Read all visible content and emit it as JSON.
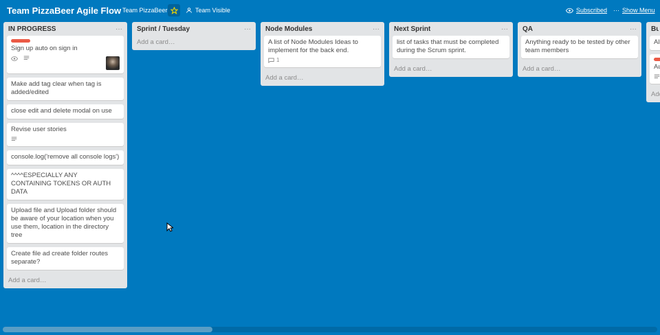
{
  "header": {
    "board_title": "Team PizzaBeer Agile Flow",
    "team": "Team PizzaBeer",
    "visibility": "Team Visible",
    "subscribed": "Subscribed",
    "show_menu": "Show Menu"
  },
  "lists": {
    "in_progress": {
      "title": "IN PROGRESS",
      "menu": "···",
      "cards": [
        "Sign up auto on sign in",
        "Make add tag clear when tag is added/edited",
        "close edit and delete modal on use",
        "Revise user stories",
        "console.log('remove all console logs')",
        "^^^^ESPECIALLY ANY CONTAINING TOKENS OR AUTH DATA",
        "Upload file and Upload folder should be aware of your location when you use them, location in the directory tree",
        "Create file ad create folder routes separate?"
      ],
      "add": "Add a card…"
    },
    "sprint": {
      "title": "Sprint / Tuesday",
      "menu": "···",
      "add": "Add a card…"
    },
    "node": {
      "title": "Node Modules",
      "menu": "···",
      "cards": [
        "A list of Node Modules Ideas to implement for the back end."
      ],
      "comment_count": "1",
      "add": "Add a card…"
    },
    "next": {
      "title": "Next Sprint",
      "menu": "···",
      "cards": [
        "list of tasks that must be completed during the Scrum sprint."
      ],
      "add": "Add a card…"
    },
    "qa": {
      "title": "QA",
      "menu": "···",
      "cards": [
        "Anything ready to be tested by other team members"
      ],
      "add": "Add a card…"
    },
    "bugs": {
      "title": "Bu",
      "cards": [
        "Al",
        "Au"
      ],
      "add": "Add"
    }
  },
  "colors": {
    "board": "#0079bf",
    "list": "#e2e4e6",
    "label_red": "#eb5a46"
  },
  "scroll": {
    "thumb_fraction": 0.32
  }
}
